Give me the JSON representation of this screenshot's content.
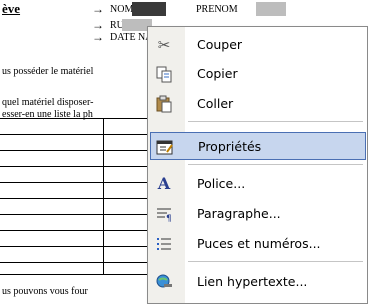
{
  "document": {
    "heading": "ève",
    "arrow": "→",
    "field_nom": "NOM",
    "field_prenom": "PRENOM",
    "field_rue": "RUE",
    "field_date": "DATE NAIS",
    "line1": "us posséder le matériel",
    "line2": "quel matériel disposer-",
    "line3": "esser-en une liste la ph",
    "line_bottom": "us pouvons vous four"
  },
  "context_menu": {
    "items": [
      {
        "label": "Couper",
        "icon": "scissors-icon"
      },
      {
        "label": "Copier",
        "icon": "copy-icon"
      },
      {
        "label": "Coller",
        "icon": "paste-icon"
      },
      {
        "label": "Propriétés",
        "icon": "properties-icon",
        "selected": true
      },
      {
        "label": "Police...",
        "icon": "font-icon"
      },
      {
        "label": "Paragraphe...",
        "icon": "paragraph-icon"
      },
      {
        "label": "Puces et numéros...",
        "icon": "bullets-icon"
      },
      {
        "label": "Lien hypertexte...",
        "icon": "hyperlink-icon"
      }
    ]
  }
}
